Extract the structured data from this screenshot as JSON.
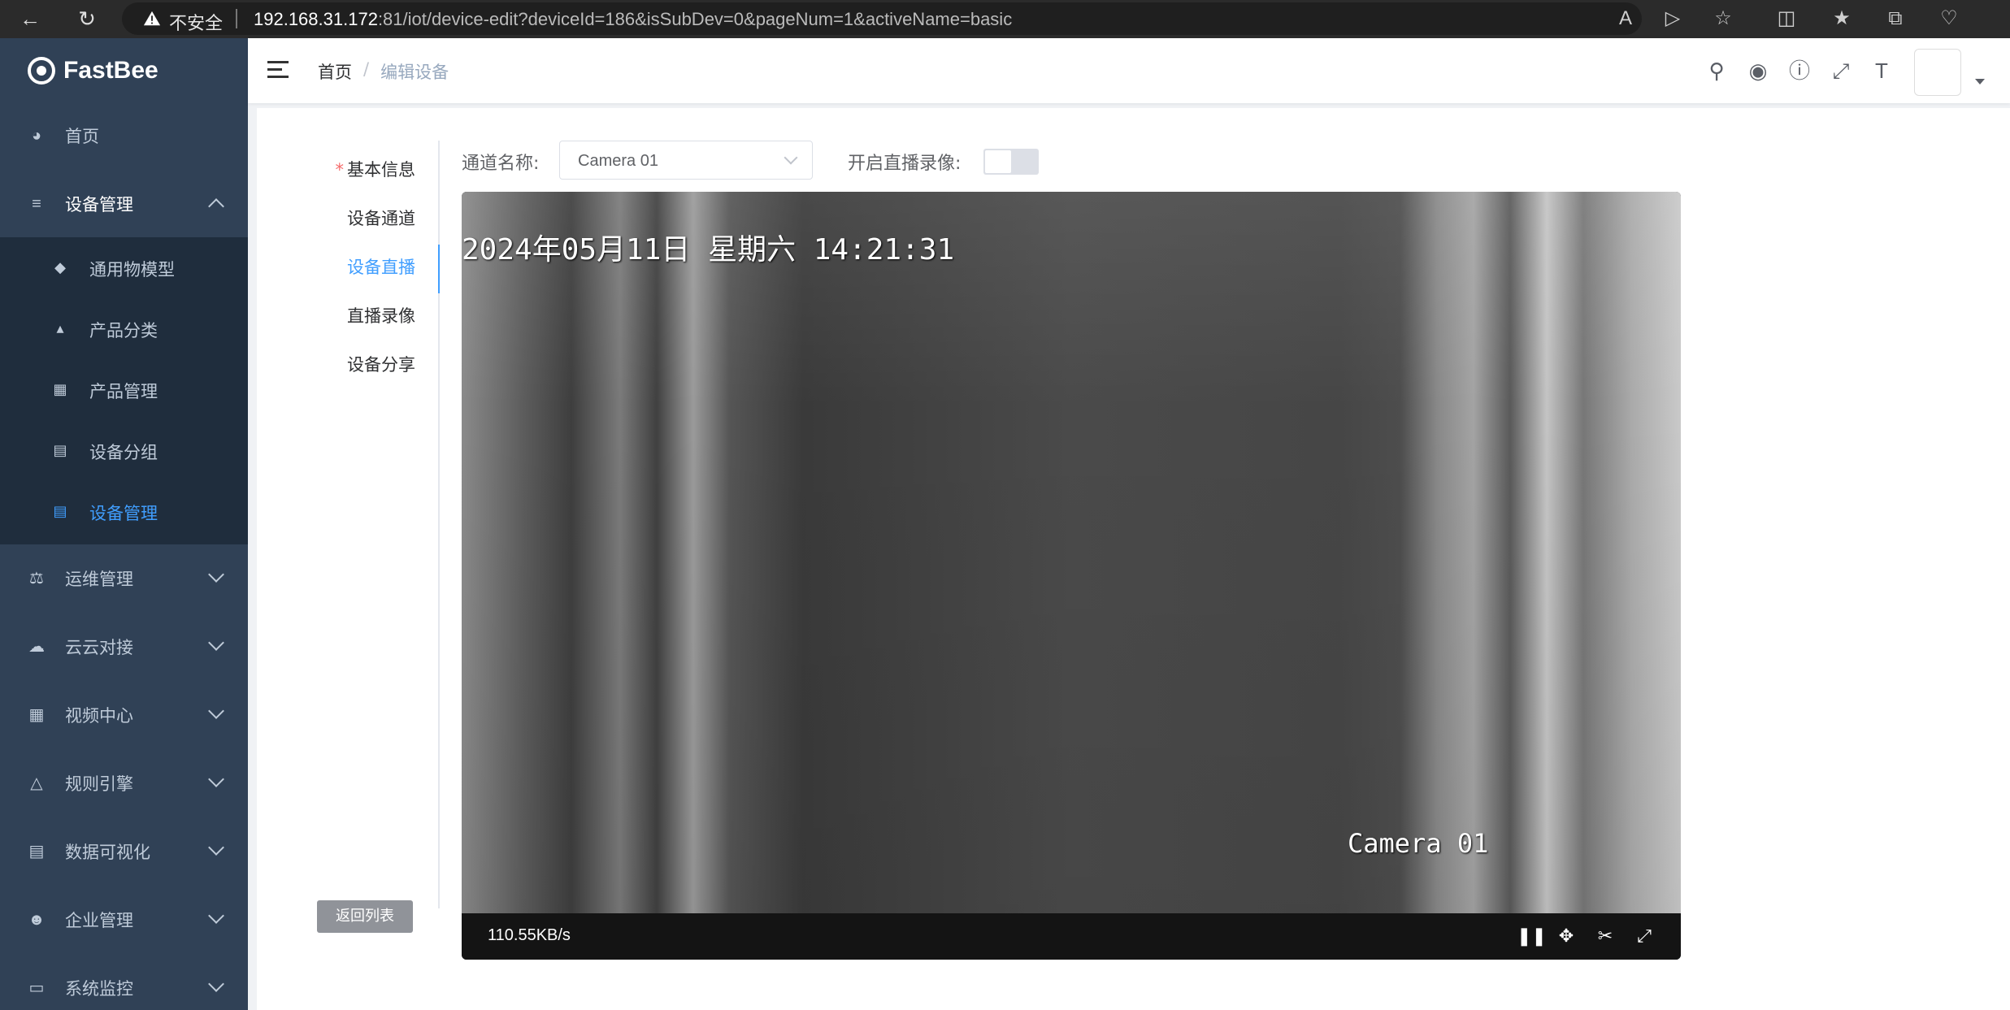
{
  "browser": {
    "warning_label": "不安全",
    "url_host": "192.168.31.172",
    "url_rest": ":81/iot/device-edit?deviceId=186&isSubDev=0&pageNum=1&activeName=basic"
  },
  "sidebar": {
    "logo": "FastBee",
    "items": [
      {
        "label": "首页",
        "icon": "dashboard-icon"
      },
      {
        "label": "设备管理",
        "icon": "layers-icon"
      },
      {
        "label": "运维管理",
        "icon": "tree-icon"
      },
      {
        "label": "云云对接",
        "icon": "cloud-icon"
      },
      {
        "label": "视频中心",
        "icon": "table-icon"
      },
      {
        "label": "规则引擎",
        "icon": "flow-icon"
      },
      {
        "label": "数据可视化",
        "icon": "chart-icon"
      },
      {
        "label": "企业管理",
        "icon": "user-icon"
      },
      {
        "label": "系统监控",
        "icon": "monitor-icon"
      }
    ],
    "submenu": [
      {
        "label": "通用物模型",
        "icon": "cube-icon"
      },
      {
        "label": "产品分类",
        "icon": "category-icon"
      },
      {
        "label": "产品管理",
        "icon": "grid-icon"
      },
      {
        "label": "设备分组",
        "icon": "group-icon"
      },
      {
        "label": "设备管理",
        "icon": "device-icon"
      }
    ]
  },
  "header": {
    "breadcrumb_home": "首页",
    "breadcrumb_sep": "/",
    "breadcrumb_current": "编辑设备"
  },
  "tabs": {
    "required_mark": "*",
    "items": [
      "基本信息",
      "设备通道",
      "设备直播",
      "直播录像",
      "设备分享"
    ],
    "back_button": "返回列表"
  },
  "form": {
    "channel_label": "通道名称:",
    "channel_value": "Camera 01",
    "record_label": "开启直播录像:",
    "record_enabled": false
  },
  "player": {
    "osd_datetime": "2024年05月11日 星期六 14:21:31",
    "osd_camera": "Camera 01",
    "speed": "110.55KB/s"
  },
  "colors": {
    "sidebar_bg": "#304156",
    "submenu_bg": "#1f2d3d",
    "accent": "#409eff"
  }
}
